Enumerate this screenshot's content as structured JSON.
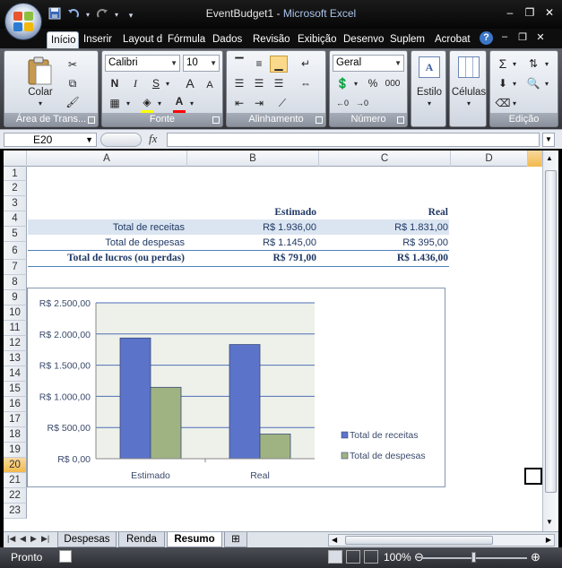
{
  "window": {
    "title_doc": "EventBudget1",
    "title_sep": " - ",
    "title_app": "Microsoft Excel"
  },
  "qat": {
    "icons": [
      "save-icon",
      "undo-icon",
      "redo-icon",
      "customize-icon"
    ]
  },
  "tabs": [
    {
      "label": "Início",
      "active": true
    },
    {
      "label": "Inserir"
    },
    {
      "label": "Layout d"
    },
    {
      "label": "Fórmula"
    },
    {
      "label": "Dados"
    },
    {
      "label": "Revisão"
    },
    {
      "label": "Exibição"
    },
    {
      "label": "Desenvo"
    },
    {
      "label": "Suplem"
    },
    {
      "label": "Acrobat"
    }
  ],
  "ribbon": {
    "clipboard": {
      "label": "Área de Trans...",
      "paste_label": "Colar"
    },
    "font": {
      "label": "Fonte",
      "font_name": "Calibri",
      "font_size": "10",
      "bold": "N",
      "italic": "I",
      "underline": "S",
      "grow": "A",
      "shrink": "A",
      "fill_color": "#ffff00",
      "font_color": "#ff0000"
    },
    "alignment": {
      "label": "Alinhamento"
    },
    "number": {
      "label": "Número",
      "format": "Geral",
      "percent": "%",
      "thousands": "000"
    },
    "styles": {
      "label": "Estilo"
    },
    "cells": {
      "label": "Células"
    },
    "editing": {
      "label": "Edição",
      "sum": "Σ"
    }
  },
  "formula_bar": {
    "name_box": "E20",
    "fx": "fx",
    "formula": ""
  },
  "columns": [
    "A",
    "B",
    "C",
    "D"
  ],
  "selected_column": "E",
  "rows": [
    "1",
    "2",
    "3",
    "4",
    "5",
    "6",
    "7",
    "8",
    "9",
    "10",
    "11",
    "12",
    "13",
    "14",
    "15",
    "16",
    "17",
    "18",
    "19",
    "20",
    "21",
    "22",
    "23"
  ],
  "selected_row": "20",
  "table": {
    "headers": [
      "Estimado",
      "Real"
    ],
    "rows": [
      {
        "label": "Total de receitas",
        "estimado": "R$ 1.936,00",
        "real": "R$ 1.831,00"
      },
      {
        "label": "Total de despesas",
        "estimado": "R$ 1.145,00",
        "real": "R$ 395,00"
      },
      {
        "label": "Total de lucros (ou perdas)",
        "estimado": "R$ 791,00",
        "real": "R$ 1.436,00"
      }
    ]
  },
  "chart_data": {
    "type": "bar",
    "categories": [
      "Estimado",
      "Real"
    ],
    "series": [
      {
        "name": "Total de receitas",
        "values": [
          1936,
          1831
        ],
        "color": "#5b73c9"
      },
      {
        "name": "Total de despesas",
        "values": [
          1145,
          395
        ],
        "color": "#9fb382"
      }
    ],
    "yticks": [
      "R$ 0,00",
      "R$ 500,00",
      "R$ 1.000,00",
      "R$ 1.500,00",
      "R$ 2.000,00",
      "R$ 2.500,00"
    ],
    "ylim": [
      0,
      2500
    ],
    "grid": true,
    "legend": "right",
    "title": "",
    "xlabel": "",
    "ylabel": ""
  },
  "sheets": [
    {
      "name": "Despesas"
    },
    {
      "name": "Renda"
    },
    {
      "name": "Resumo",
      "active": true
    }
  ],
  "status": {
    "text": "Pronto",
    "zoom": "100%",
    "zoom_fraction": 0.5
  }
}
